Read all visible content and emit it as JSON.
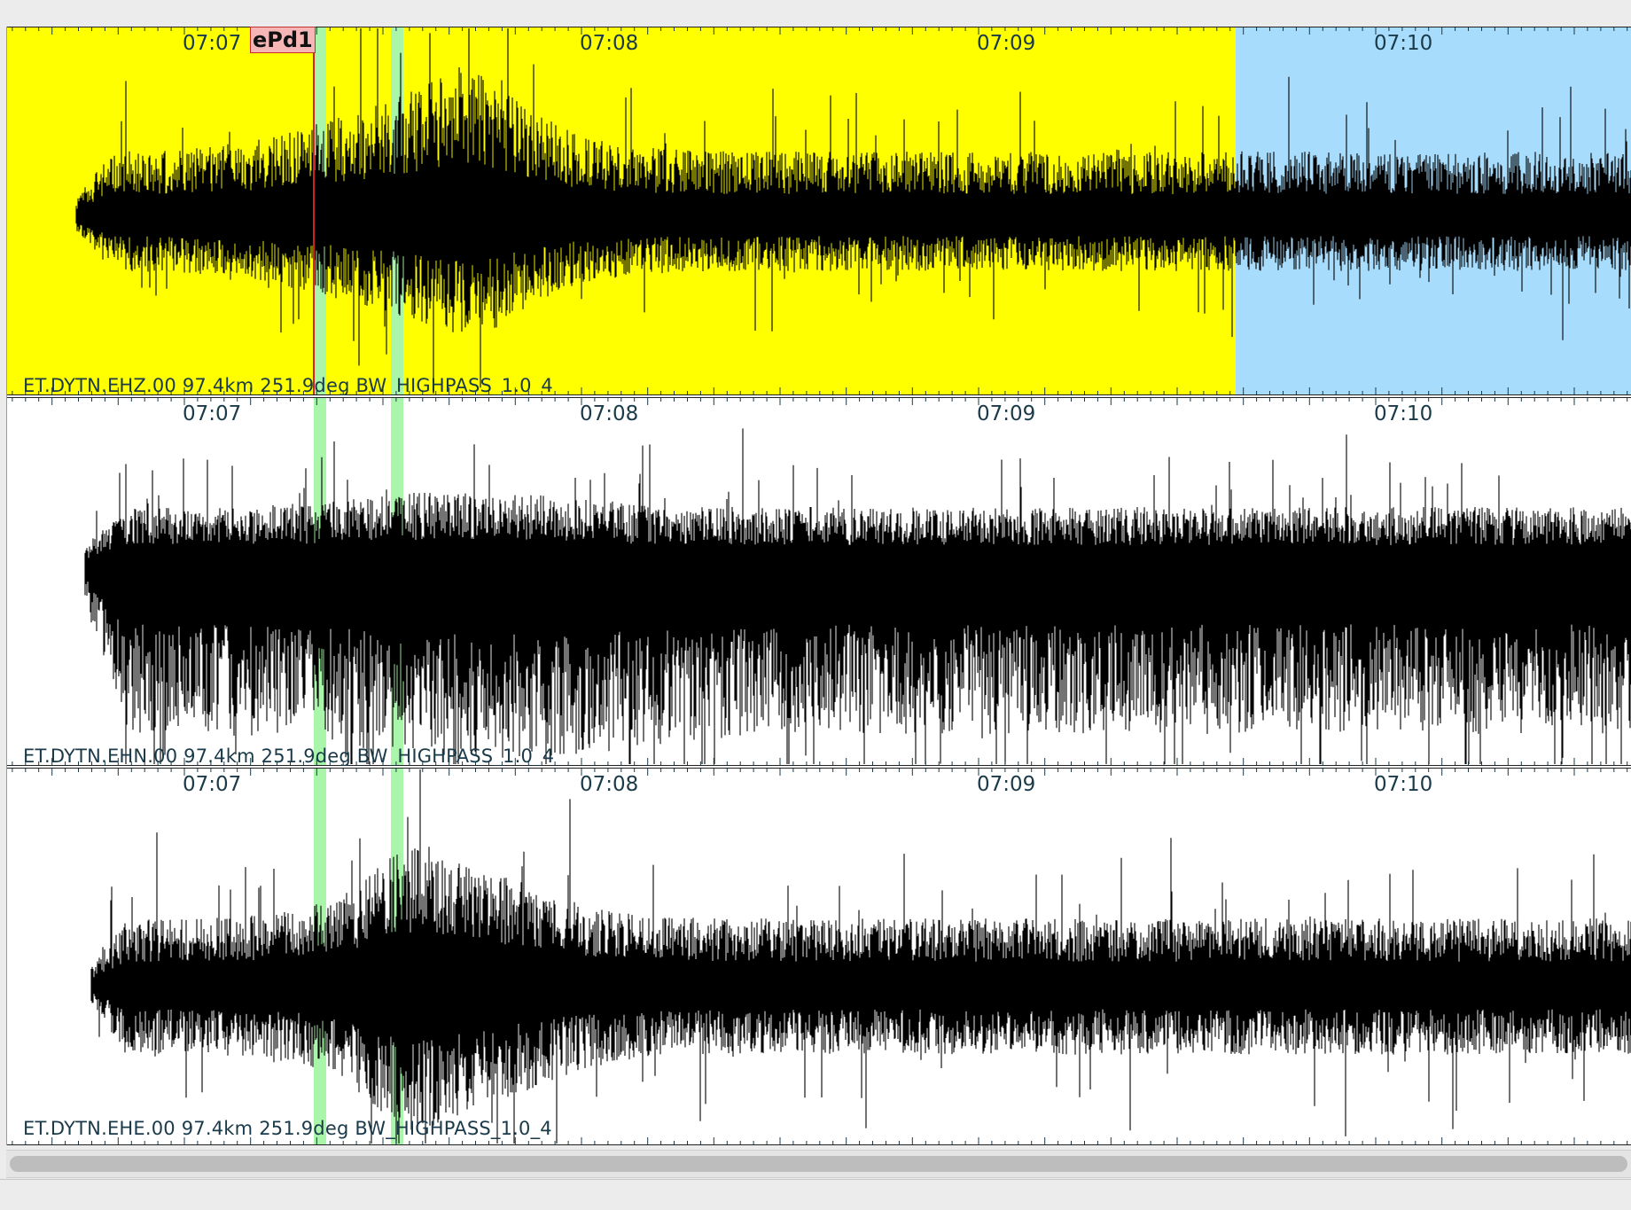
{
  "window": {
    "background": "#ececec"
  },
  "colors": {
    "selected_panel_bg": "#ffff00",
    "window_highlight_bg": "#a8dcfc",
    "phase_marker": "#a9f5a9",
    "pick_line": "#cc2222",
    "waveform": "#000000",
    "label_text": "#1a3a4a"
  },
  "time_axis": {
    "ticks": [
      "07:07",
      "07:08",
      "07:09",
      "07:10"
    ]
  },
  "pick": {
    "label": "ePd1"
  },
  "traces": [
    {
      "id": "ehz",
      "label": "ET.DYTN.EHZ.00 97.4km 251.9deg BW_HIGHPASS_1.0_4",
      "selected": true
    },
    {
      "id": "ehn",
      "label": "ET.DYTN.EHN.00 97.4km 251.9deg BW_HIGHPASS_1.0_4",
      "selected": false
    },
    {
      "id": "ehe",
      "label": "ET.DYTN.EHE.00 97.4km 251.9deg BW_HIGHPASS_1.0_4",
      "selected": false
    }
  ],
  "scrollbar": {
    "position": 0.0,
    "extent": 1.0
  }
}
